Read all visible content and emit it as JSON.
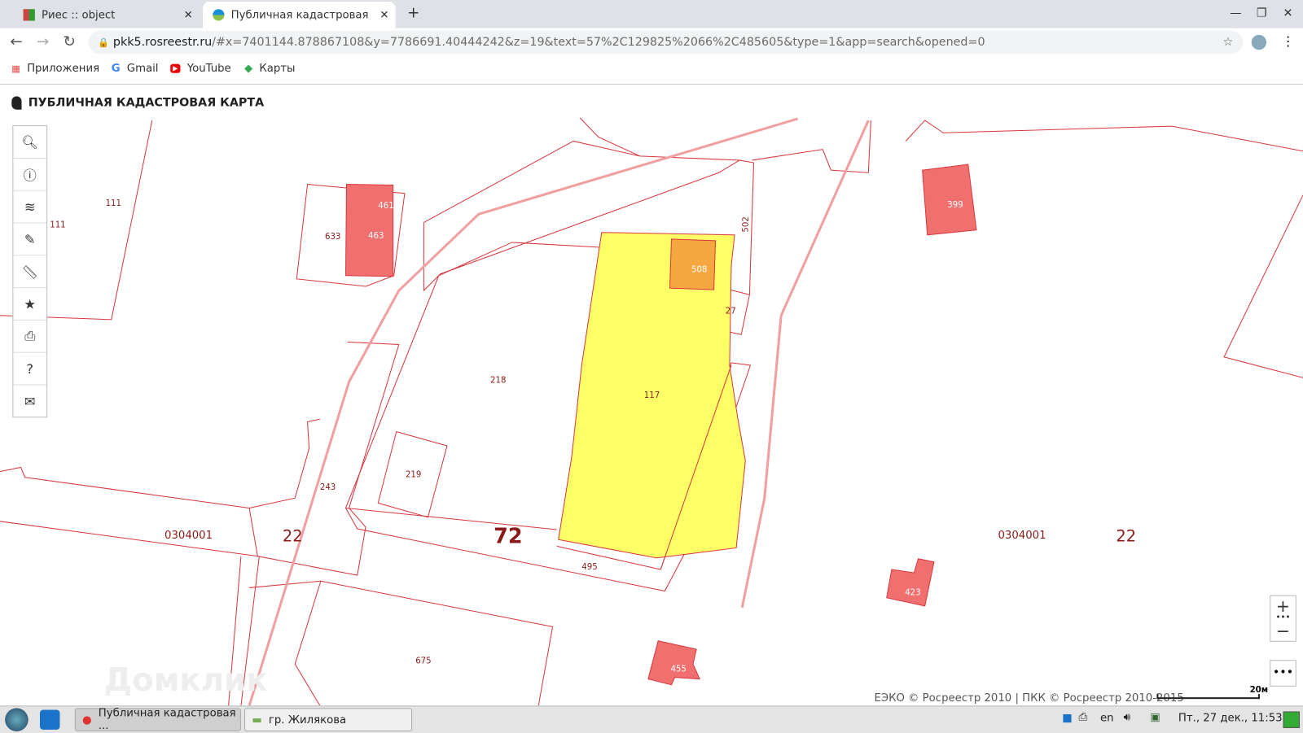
{
  "browser": {
    "tabs": [
      {
        "label": "Риес :: object",
        "active": false
      },
      {
        "label": "Публичная кадастровая карта",
        "active": true
      }
    ],
    "new_tab": "+",
    "url_host": "pkk5.rosreestr.ru",
    "url_rest": "/#x=7401144.878867108&y=7786691.40444242&z=19&text=57%2C129825%2066%2C485605&type=1&app=search&opened=0",
    "bookmarks": [
      "Приложения",
      "Gmail",
      "YouTube",
      "Карты"
    ]
  },
  "app": {
    "title": "ПУБЛИЧНАЯ КАДАСТРОВАЯ КАРТА",
    "tools": [
      "search-icon",
      "info-icon",
      "layers-icon",
      "pencil-icon",
      "ruler-icon",
      "star-icon",
      "print-icon",
      "help-icon",
      "mail-icon"
    ],
    "attribution": "ЕЭКО © Росреестр 2010 | ПКК © Росреестр 2010-2015",
    "scale_label": "20м",
    "watermark": "Домклик"
  },
  "map_labels": {
    "p111a": "111",
    "p111b": "111",
    "p633": "633",
    "p461": "461",
    "p463": "463",
    "p502": "502",
    "p508": "508",
    "p27": "27",
    "p218": "218",
    "p117": "117",
    "p219": "219",
    "p243": "243",
    "q1": "0304001",
    "d1": "22",
    "big72": "72",
    "p495": "495",
    "q2": "0304001",
    "d2": "22",
    "p399": "399",
    "p423": "423",
    "p455": "455",
    "p675": "675"
  },
  "colors": {
    "boundary": "#d9363e",
    "selected": "#ffff66",
    "orange": "#f5a742",
    "red": "#f07070"
  },
  "taskbar": {
    "items": [
      "Публичная кадастровая ...",
      "гр. Жилякова"
    ],
    "lang": "en",
    "clock": "Пт., 27 дек., 11:53"
  }
}
